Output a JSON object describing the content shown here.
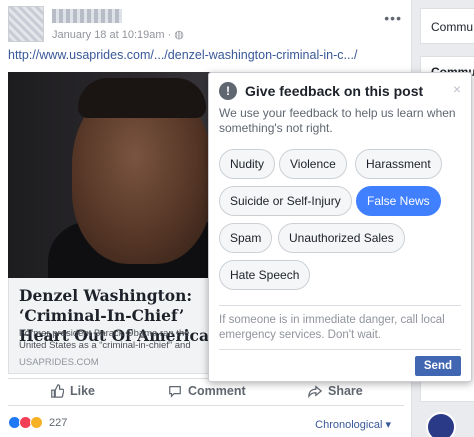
{
  "post": {
    "timestamp": "January 18 at 10:19am · ",
    "link": "http://www.usaprides.com/.../denzel-washington-criminal-in-c.../",
    "article": {
      "title": "Denzel Washington: ‘Criminal-In-Chief’ Heart Out Of America’",
      "description": "Former president Barack Obama ran the United States as a “criminal-in-chief” and enriched himself and his...",
      "domain": "USAPRIDES.COM"
    },
    "actions": {
      "like": "Like",
      "comment": "Comment",
      "share": "Share"
    },
    "reactions_count": "227",
    "sort_label": "Chronological ▾"
  },
  "right_column": {
    "box1": "Commu",
    "box2": "Commu"
  },
  "feedback": {
    "title": "Give feedback on this post",
    "description": "We use your feedback to help us learn when something's not right.",
    "options": [
      "Nudity",
      "Violence",
      "Harassment",
      "Suicide or Self-Injury",
      "False News",
      "Spam",
      "Unauthorized Sales",
      "Hate Speech"
    ],
    "selected": "False News",
    "note": "If someone is in immediate danger, call local emergency services. Don't wait.",
    "send": "Send",
    "close": "×"
  }
}
